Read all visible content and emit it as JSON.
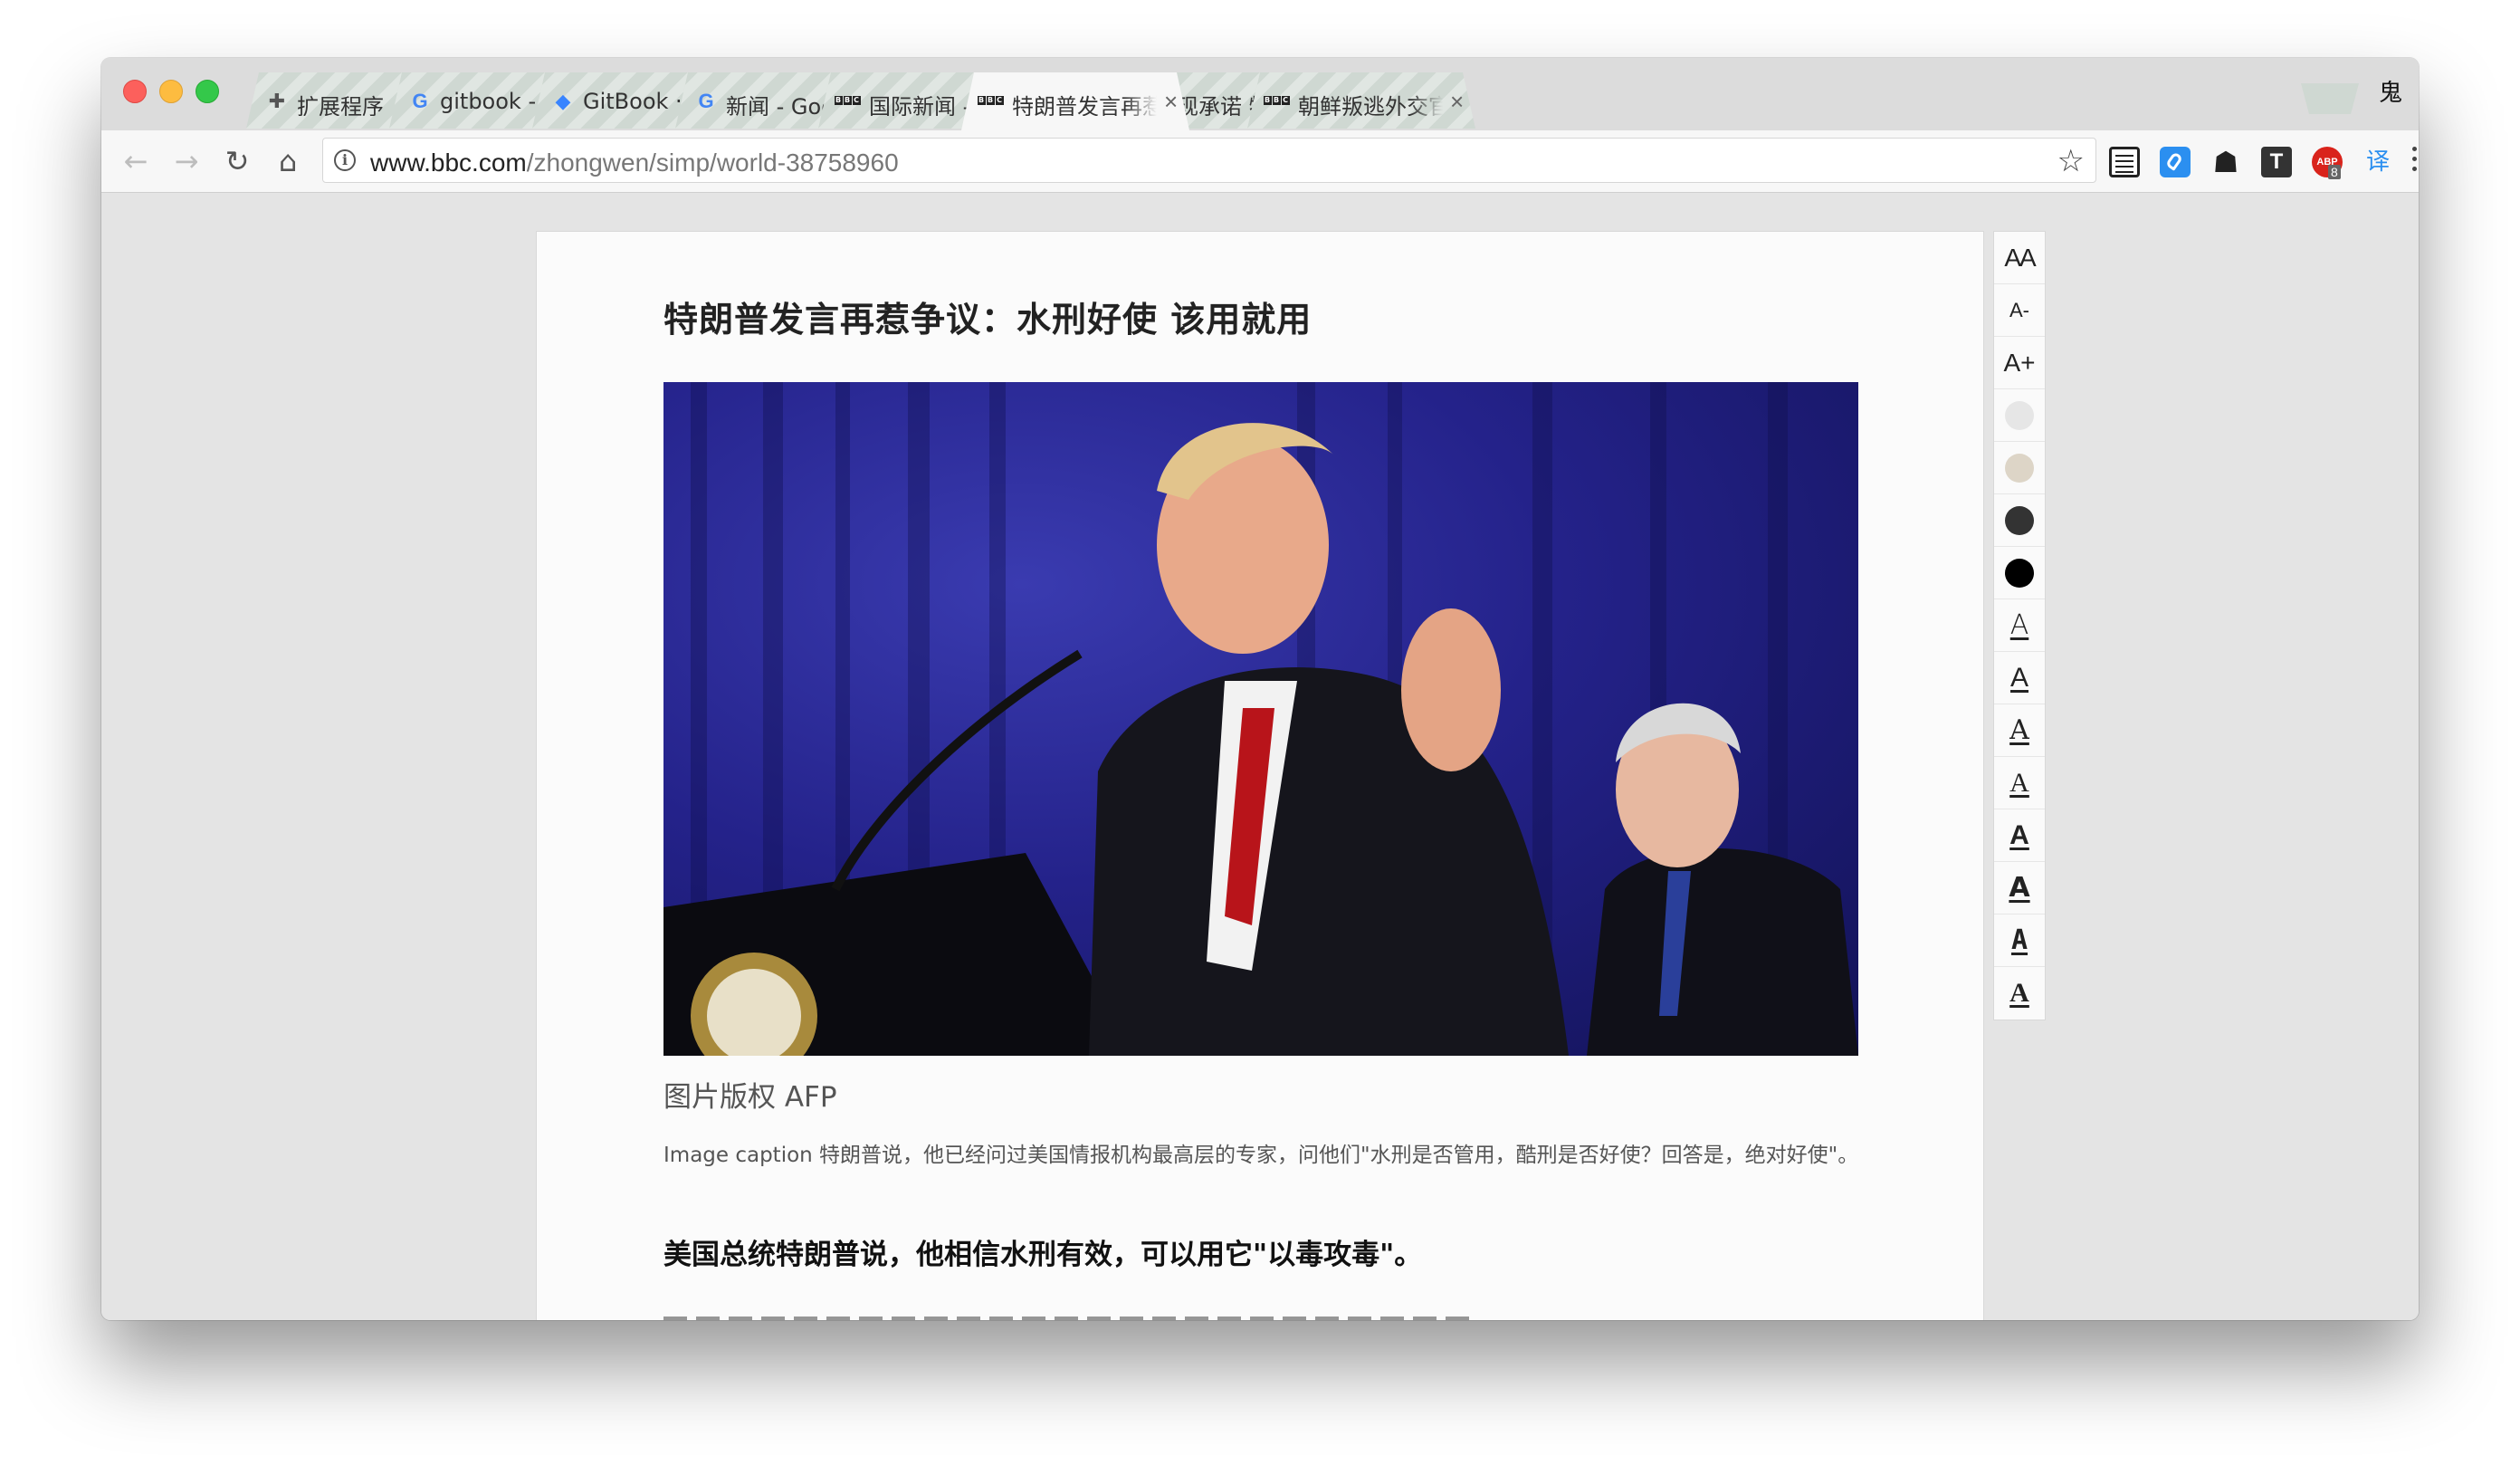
{
  "browser": {
    "tabs": [
      {
        "title": "扩展程序",
        "favicon": "puzzle-icon",
        "active": false
      },
      {
        "title": "gitbook - Goog",
        "favicon": "google-icon",
        "active": false
      },
      {
        "title": "GitBook · Docu",
        "favicon": "gitbook-icon",
        "active": false
      },
      {
        "title": "新闻 - Google 搜",
        "favicon": "google-icon",
        "active": false
      },
      {
        "title": "国际新闻 - BBC",
        "favicon": "bbc-icon",
        "active": false
      },
      {
        "title": "特朗普发言再惹",
        "favicon": "bbc-icon",
        "active": true
      },
      {
        "title": "兑现承诺 特朗普",
        "favicon": "bbc-icon",
        "active": false
      },
      {
        "title": "朝鲜叛逃外交官",
        "favicon": "bbc-icon",
        "active": false
      }
    ],
    "profile_label": "鬼",
    "url_host": "www.bbc.com",
    "url_path": "/zhongwen/simp/world-38758960",
    "extensions": {
      "abp_count": "8",
      "translate_label": "译"
    }
  },
  "article": {
    "headline": "特朗普发言再惹争议：水刑好使 该用就用",
    "photo_credit": "图片版权 AFP",
    "caption": "Image caption 特朗普说，他已经问过美国情报机构最高层的专家，问他们\"水刑是否管用，酷刑是否好使？回答是，绝对好使\"。",
    "lead": "美国总统特朗普说，他相信水刑有效，可以用它\"以毒攻毒\"。"
  },
  "reader_sidebar": {
    "font_size_label": "AA",
    "decrease_label": "A-",
    "increase_label": "A+",
    "themes": [
      {
        "name": "light",
        "color": "#e6e6e6"
      },
      {
        "name": "sepia",
        "color": "#ddd5c7"
      },
      {
        "name": "dark",
        "color": "#333333"
      },
      {
        "name": "black",
        "color": "#000000"
      }
    ],
    "font_option_label": "A"
  },
  "colors": {
    "tab_inactive": "#cfd8d2",
    "tab_active": "#f7f7f7",
    "page_bg": "#e4e4e4",
    "link_blue": "#2b8ff0"
  }
}
